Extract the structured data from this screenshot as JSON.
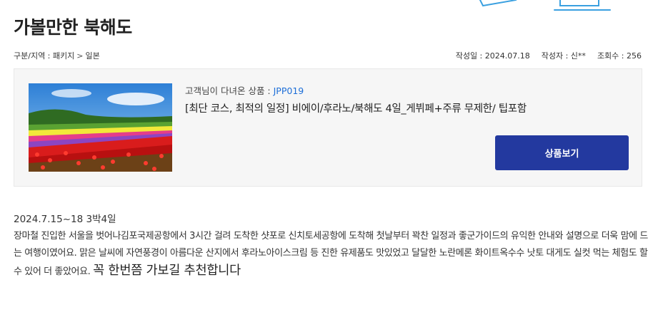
{
  "page": {
    "title": "가볼만한 북해도"
  },
  "breadcrumb": {
    "category_label": "구분/지역 : 패키지",
    "separator": ">",
    "region": "일본"
  },
  "meta": {
    "date": "작성일 : 2024.07.18",
    "author": "작성자 : 신**",
    "views": "조회수 : 256"
  },
  "product": {
    "label_prefix": "고객님이 다녀온 상품 : ",
    "code": "JPP019",
    "name": "[최단 코스, 최적의 일정] 비에이/후라노/북해도 4일_게뷔페+주류 무제한/ 팁포함",
    "view_button": "상품보기"
  },
  "review": {
    "date_line": "2024.7.15~18 3박4일",
    "body": "장마철 진입한 서울을 벗어나김포국제공항에서 3시간 걸려 도착한  샷포로 신치토세공항에 도착해 첫날부터 꽉찬 일정과 좋군가이드의 유익한 안내와 설명으로 더욱 맘에 드는 여행이였어요. 맑은 날씨에 자연풍경이 아름다운 산지에서 후라노아이스크림 등 진한 유제품도 맛있었고 달달한 노란메론 화이트옥수수 낫토 대게도 실컷 먹는 체험도 할 수 있어 더 좋았어요. ",
    "emphasis": "꼭 한번쯤 가보길 추천합니다"
  },
  "colors": {
    "button_bg": "#23399f",
    "code_link": "#1e6fd8",
    "box_bg": "#f6f6f6",
    "deco_line": "#3aa0e0"
  }
}
